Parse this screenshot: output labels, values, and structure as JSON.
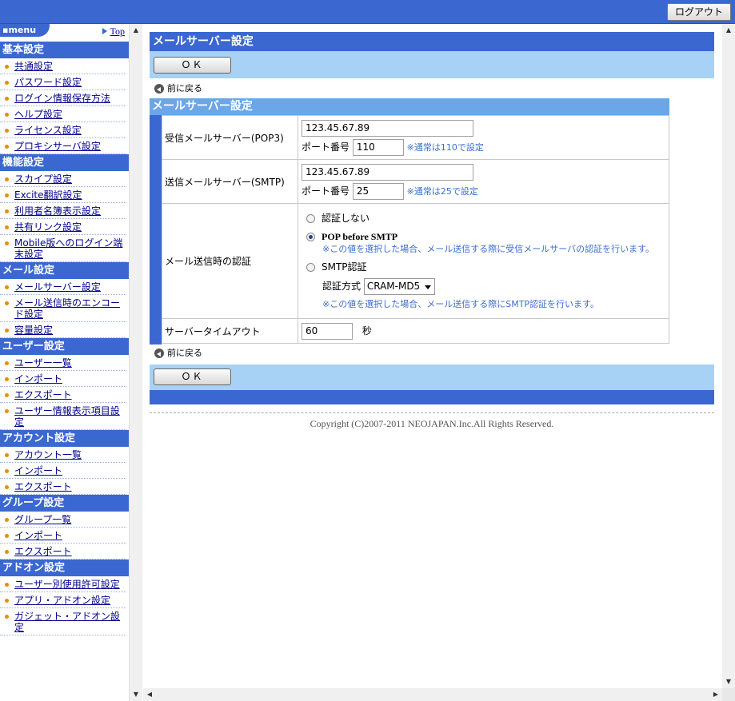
{
  "header": {
    "logout_label": "ログアウト"
  },
  "sidebar": {
    "menu_label": "menu",
    "top_label": "Top",
    "sections": [
      {
        "title": "基本設定",
        "items": [
          "共通設定",
          "パスワード設定",
          "ログイン情報保存方法",
          "ヘルプ設定",
          "ライセンス設定",
          "プロキシサーバ設定"
        ]
      },
      {
        "title": "機能設定",
        "items": [
          "スカイプ設定",
          "Excite翻訳設定",
          "利用者名簿表示設定",
          "共有リンク設定",
          "Mobile版へのログイン端末設定"
        ]
      },
      {
        "title": "メール設定",
        "items": [
          "メールサーバー設定",
          "メール送信時のエンコード設定",
          "容量設定"
        ]
      },
      {
        "title": "ユーザー設定",
        "items": [
          "ユーザー一覧",
          "インポート",
          "エクスポート",
          "ユーザー情報表示項目設定"
        ]
      },
      {
        "title": "アカウント設定",
        "items": [
          "アカウント一覧",
          "インポート",
          "エクスポート"
        ]
      },
      {
        "title": "グループ設定",
        "items": [
          "グループ一覧",
          "インポート",
          "エクスポート"
        ]
      },
      {
        "title": "アドオン設定",
        "items": [
          "ユーザー別使用許可設定",
          "アプリ・アドオン設定",
          "ガジェット・アドオン設定"
        ]
      }
    ]
  },
  "main": {
    "page_title": "メールサーバー設定",
    "ok_label": "ＯＫ",
    "back_label": "前に戻る",
    "form_title": "メールサーバー設定",
    "pop3": {
      "label": "受信メールサーバー(POP3)",
      "host": "123.45.67.89",
      "port_label": "ポート番号",
      "port": "110",
      "note": "※通常は110で設定"
    },
    "smtp": {
      "label": "送信メールサーバー(SMTP)",
      "host": "123.45.67.89",
      "port_label": "ポート番号",
      "port": "25",
      "note": "※通常は25で設定"
    },
    "auth": {
      "label": "メール送信時の認証",
      "opt_none": "認証しない",
      "opt_pop": "POP before SMTP",
      "pop_note": "※この値を選択した場合、メール送信する際に受信メールサーバの認証を行います。",
      "opt_smtp": "SMTP認証",
      "method_label": "認証方式",
      "method_value": "CRAM-MD5",
      "smtp_note": "※この値を選択した場合、メール送信する際にSMTP認証を行います。",
      "selected": "POP before SMTP"
    },
    "timeout": {
      "label": "サーバータイムアウト",
      "value": "60",
      "unit": "秒"
    },
    "copyright": "Copyright (C)2007-2011 NEOJAPAN.Inc.All Rights Reserved."
  }
}
